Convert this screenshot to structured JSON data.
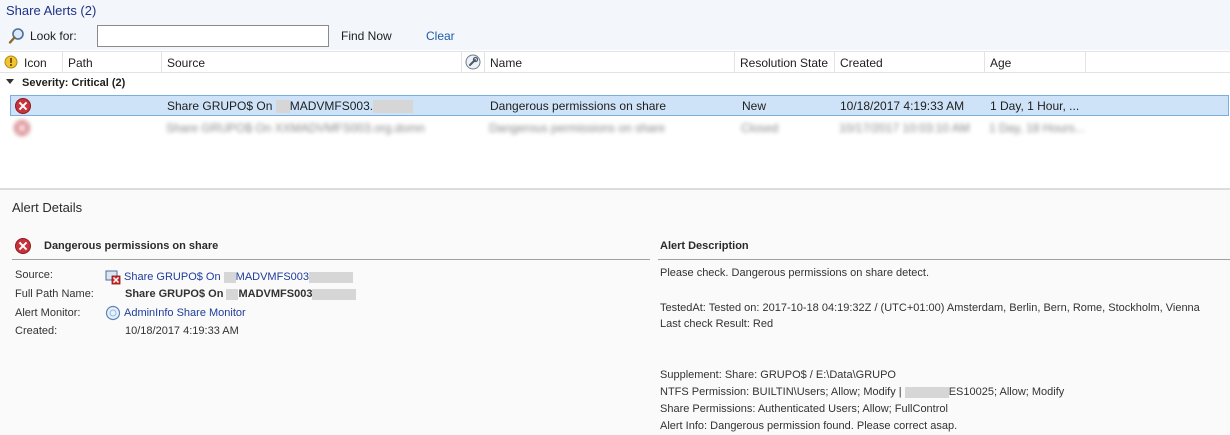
{
  "header": {
    "title": "Share Alerts (2)"
  },
  "search": {
    "label": "Look for:",
    "value": "",
    "find_now": "Find Now",
    "clear": "Clear"
  },
  "columns": {
    "icon": "Icon",
    "path": "Path",
    "source": "Source",
    "name": "Name",
    "resolution_state": "Resolution State",
    "created": "Created",
    "age": "Age"
  },
  "group": {
    "label": "Severity: Critical (2)"
  },
  "rows": [
    {
      "source_prefix": "Share GRUPO$ On",
      "source_host": "MADVMFS003.",
      "name": "Dangerous permissions on share",
      "resolution_state": "New",
      "created": "10/18/2017 4:19:33 AM",
      "age": "1 Day, 1 Hour, ..."
    },
    {
      "source_prefix": "Share GRUPO$ On XXMADVMFS003.org.domn",
      "name": "Dangerous permissions on share",
      "resolution_state": "Closed",
      "created": "10/17/2017 10:03:10 AM",
      "age": "1 Day, 18 Hours..."
    }
  ],
  "details": {
    "title": "Alert Details",
    "alert_name": "Dangerous permissions on share",
    "labels": {
      "source": "Source:",
      "full_path": "Full Path Name:",
      "monitor": "Alert Monitor:",
      "created": "Created:"
    },
    "source_prefix": "Share GRUPO$ On",
    "source_host": "MADVMFS003",
    "full_path_prefix": "Share GRUPO$ On",
    "full_path_host": "MADVMFS003",
    "monitor": "AdminInfo Share Monitor",
    "created": "10/18/2017 4:19:33 AM"
  },
  "description": {
    "title": "Alert Description",
    "line1": "Please check. Dangerous permissions on share detect.",
    "line2": "TestedAt: Tested on: 2017-10-18 04:19:32Z / (UTC+01:00) Amsterdam, Berlin, Bern, Rome, Stockholm, Vienna",
    "line3": "Last check Result: Red",
    "line4": "Supplement: Share: GRUPO$ / E:\\Data\\GRUPO",
    "line5_prefix": "NTFS Permission: BUILTIN\\Users; Allow; Modify |",
    "line5_suffix": "ES10025; Allow; Modify",
    "line6": "Share Permissions: Authenticated Users; Allow; FullControl",
    "line7": "Alert Info: Dangerous permission found. Please correct asap."
  },
  "colors": {
    "accent": "#1e3287",
    "selection": "#cfe3f8",
    "critical": "#c8323c"
  }
}
